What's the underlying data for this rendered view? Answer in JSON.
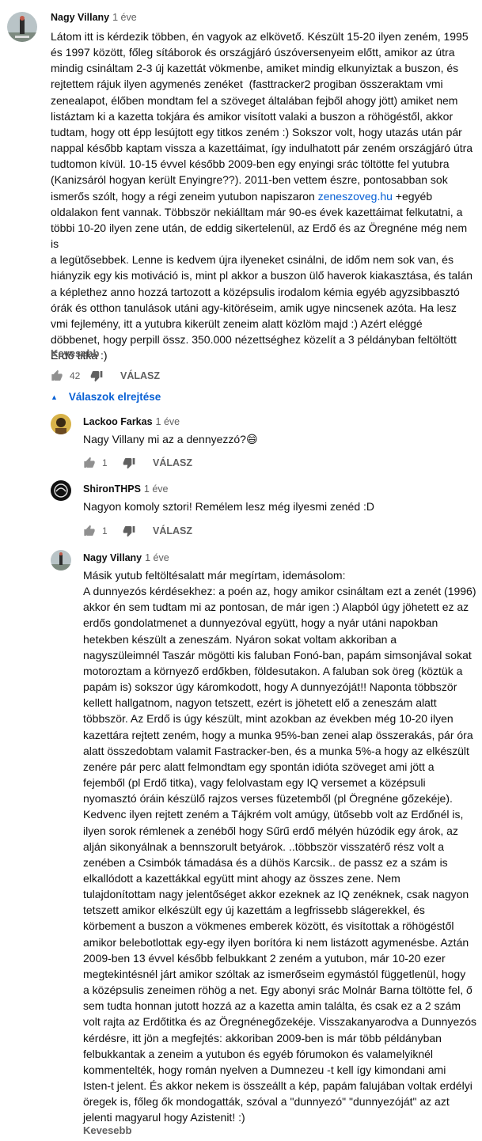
{
  "main_comment": {
    "author": "Nagy Villany",
    "time": "1 éve",
    "text_before_link": "Látom itt is kérdezik többen, én vagyok az elkövető. Készült 15-20 ilyen zeném, 1995\nés 1997 között, főleg sítáborok és országjáró úszóversenyeim előtt, amikor az útra\nmindig csináltam 2-3 új kazettát vökmenbe, amiket mindig elkunyiztak a buszon, és\nrejtettem rájuk ilyen agymenés zenéket  (fasttracker2 progiban összeraktam vmi\nzenealapot, élőben mondtam fel a szöveget általában fejből ahogy jött) amiket nem\nlistáztam ki a kazetta tokjára és amikor visított valaki a buszon a röhögéstől, akkor\ntudtam, hogy ott épp lesújtott egy titkos zeném :) Sokszor volt, hogy utazás után pár\nnappal később kaptam vissza a kazettáimat, így indulhatott pár zeném országjáró útra\ntudtomon kívül. 10-15 évvel később 2009-ben egy enyingi srác töltötte fel yutubra\n(Kanizsáról hogyan került Enyingre??). 2011-ben vettem észre, pontosabban sok\nismerős szólt, hogy a régi zeneim yutubon napiszaron ",
    "link_text": "zeneszoveg.hu",
    "text_after_link": " +egyéb\noldalakon fent vannak. Többször nekiálltam már 90-es évek kazettáimat felkutatni, a\ntöbbi 10-20 ilyen zene után, de eddig sikertelenül, az Erdő és az Öregnéne még nem is\na legütősebbek. Lenne is kedvem újra ilyeneket csinálni, de időm nem sok van, és\nhiányzik egy kis motiváció is, mint pl akkor a buszon ülő haverok kiakasztása, és talán\na képlethez anno hozzá tartozott a középsulis irodalom kémia egyéb agyzsibbasztó\nórák és otthon tanulások utáni agy-kitöréseim, amik ugye nincsenek azóta. Ha lesz\nvmi fejlemény, itt a yutubra kikerült zeneim alatt közlöm majd :) Azért eléggé\ndöbbenet, hogy perpill össz. 350.000 nézettséghez közelít a 3 példányban feltöltött\nErdő titka :)",
    "less_label": "Kevesebb",
    "like_count": "42",
    "reply_label": "VÁLASZ"
  },
  "replies_toggle": {
    "label": "Válaszok elrejtése"
  },
  "replies": [
    {
      "author": "Lackoo Farkas",
      "time": "1 éve",
      "text": "Nagy Villany mi az a dennyezzó?😄",
      "like_count": "1",
      "reply_label": "VÁLASZ"
    },
    {
      "author": "ShironTHPS",
      "time": "1 éve",
      "text": "Nagyon komoly sztori! Remélem lesz még ilyesmi zenéd :D",
      "like_count": "1",
      "reply_label": "VÁLASZ"
    },
    {
      "author": "Nagy Villany",
      "time": "1 éve",
      "text": "Másik yutub feltöltésalatt már megírtam, idemásolom:\nA dunnyezós kérdésekhez: a poén az, hogy amikor csináltam ezt a zenét (1996)\nakkor én sem tudtam mi az pontosan, de már igen :) Alapból úgy jöhetett ez az\nerdős gondolatmenet a dunnyezóval együtt, hogy a nyár utáni napokban\nhetekben készült a zeneszám. Nyáron sokat voltam akkoriban a\nnagyszüleimnél Taszár mögötti kis faluban Fonó-ban, papám simsonjával sokat\nmotoroztam a környező erdőkben, földesutakon. A faluban sok öreg (köztük a\npapám is) sokszor úgy káromkodott, hogy A dunnyezóját!! Naponta többször\nkellett hallgatnom, nagyon tetszett, ezért is jöhetett elő a zeneszám alatt\ntöbbször. Az Erdő is úgy készült, mint azokban az években még 10-20 ilyen\nkazettára rejtett zeném, hogy a munka 95%-ban zenei alap összerakás, pár óra\nalatt összedobtam valamit Fastracker-ben, és a munka 5%-a hogy az elkészült\nzenére pár perc alatt felmondtam egy spontán idióta szöveget ami jött a\nfejemből (pl Erdő titka), vagy felolvastam egy IQ versemet a középsuli\nnyomasztó óráin készülő rajzos verses füzetemből (pl Öregnéne gőzekéje).\nKedvenc ilyen rejtett zeném a Tájkrém volt amúgy, ütősebb volt az Erdőnél is,\nilyen sorok rémlenek a zenéből hogy Sűrű erdő mélyén húzódik egy árok, az\nalján sikonyálnak a bennszorult betyárok. ..többször visszatérő rész volt a\nzenében a Csimbók támadása és a dühös Karcsik.. de passz ez a szám is\nelkallódott a kazettákkal együtt mint ahogy az összes zene. Nem\ntulajdonítottam nagy jelentőséget akkor ezeknek az IQ zenéknek, csak nagyon\ntetszett amikor elkészült egy új kazettám a legfrissebb slágerekkel, és\nkörbement a buszon a vökmenes emberek között, és visítottak a röhögéstől\namikor belebotlottak egy-egy ilyen borítóra ki nem listázott agymenésbe. Aztán\n2009-ben 13 évvel később felbukkant 2 zeném a yutubon, már 10-20 ezer\nmegtekintésnél járt amikor szóltak az ismerőseim egymástól függetlenül, hogy\na középsulis zeneimen röhög a net. Egy abonyi srác Molnár Barna töltötte fel, ő\nsem tudta honnan jutott hozzá az a kazetta amin találta, és csak ez a 2 szám\nvolt rajta az Erdőtitka és az Öregnénegőzekéje. Visszakanyarodva a Dunnyezós\nkérdésre, itt jön a megfejtés: akkoriban 2009-ben is már több példányban\nfelbukkantak a zeneim a yutubon és egyéb fórumokon és valamelyiknél\nkommentelték, hogy román nyelven a Dumnezeu -t kell így kimondani ami\nIsten-t jelent. És akkor nekem is összeállt a kép, papám falujában voltak erdélyi\nöregek is, főleg ők mondogatták, szóval a \"dunnyezó\" \"dunnyezóját\" az azt\njelenti magyarul hogy Azistenit! :)",
      "less_label": "Kevesebb"
    }
  ]
}
